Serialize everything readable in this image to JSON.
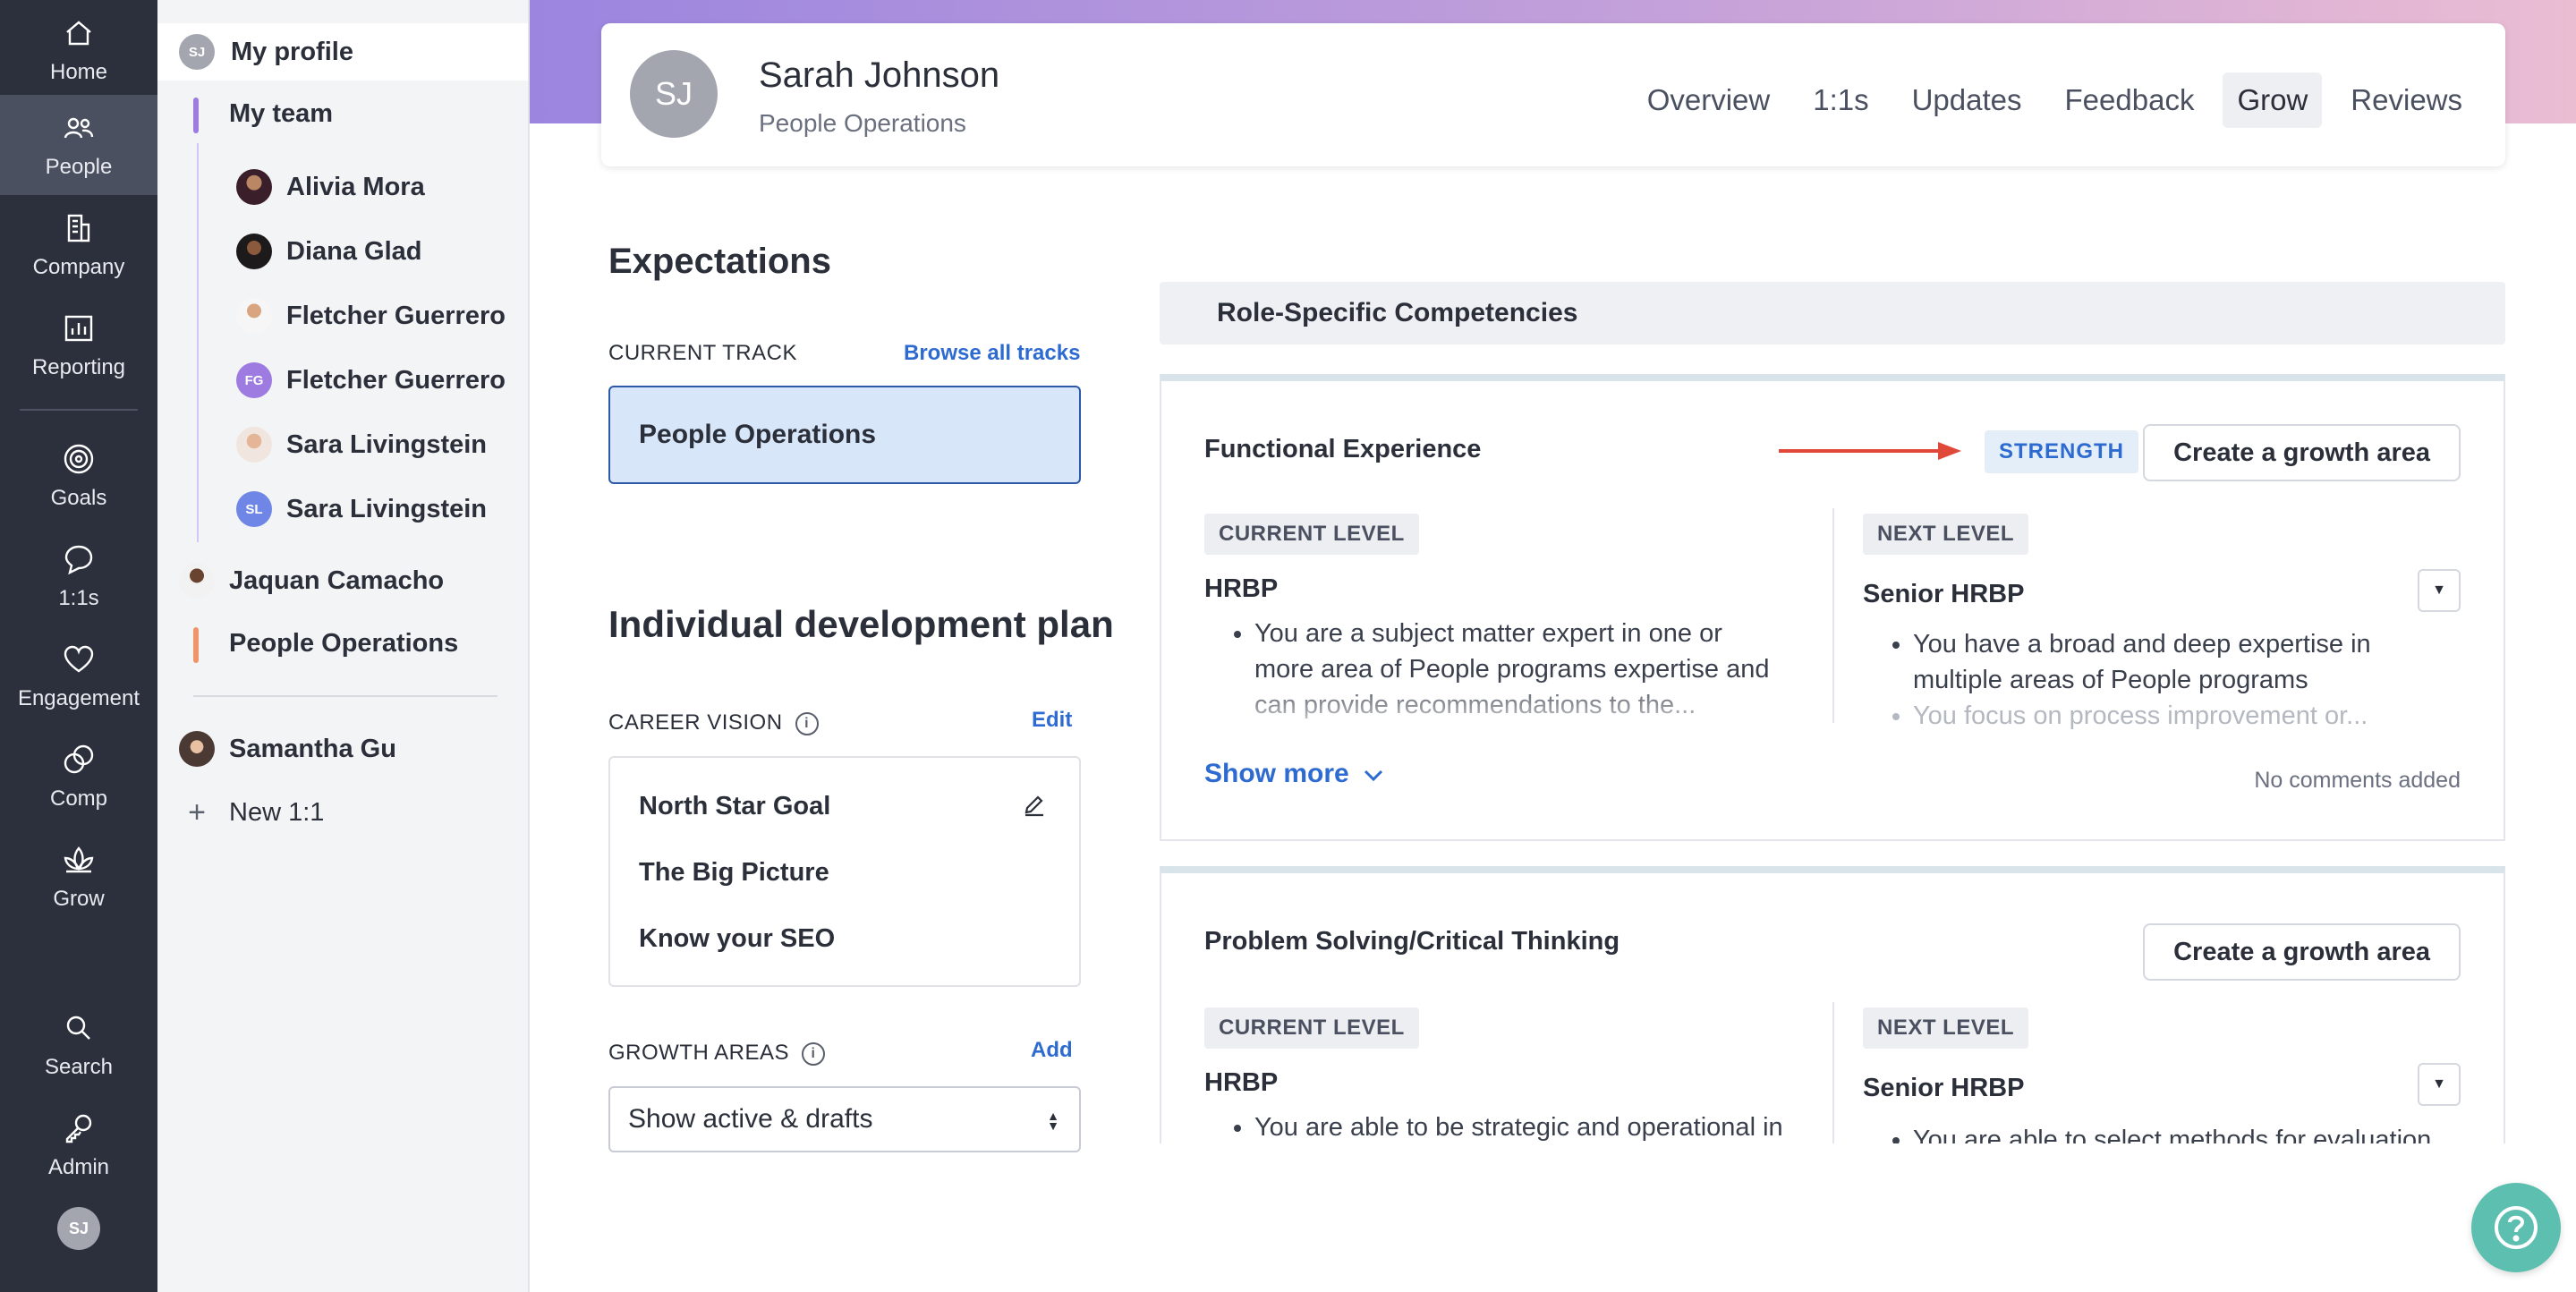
{
  "rail": {
    "items": [
      {
        "label": "Home",
        "icon": "home-icon"
      },
      {
        "label": "People",
        "icon": "people-icon",
        "active": true
      },
      {
        "label": "Company",
        "icon": "company-icon"
      },
      {
        "label": "Reporting",
        "icon": "reporting-icon"
      },
      {
        "label": "Goals",
        "icon": "goals-icon"
      },
      {
        "label": "1:1s",
        "icon": "chat-icon"
      },
      {
        "label": "Engagement",
        "icon": "heart-icon"
      },
      {
        "label": "Comp",
        "icon": "coins-icon"
      },
      {
        "label": "Grow",
        "icon": "lotus-icon"
      },
      {
        "label": "Search",
        "icon": "search-icon"
      },
      {
        "label": "Admin",
        "icon": "key-icon"
      }
    ],
    "avatar_initials": "SJ"
  },
  "subnav": {
    "my_profile": {
      "label": "My profile",
      "initials": "SJ"
    },
    "my_team": "My team",
    "team": [
      {
        "name": "Alivia Mora"
      },
      {
        "name": "Diana Glad"
      },
      {
        "name": "Fletcher Guerrero"
      },
      {
        "name": "Fletcher Guerrero",
        "initials": "FG"
      },
      {
        "name": "Sara Livingstein"
      },
      {
        "name": "Sara Livingstein",
        "initials": "SL"
      }
    ],
    "jaquan": "Jaquan Camacho",
    "people_ops": "People Operations",
    "samantha": "Samantha Gu",
    "new_1on1": "New 1:1",
    "colors": {
      "team_bar": "#9d7be0",
      "people_ops_bar": "#f0956a"
    }
  },
  "header": {
    "initials": "SJ",
    "name": "Sarah Johnson",
    "dept": "People Operations",
    "tabs": [
      "Overview",
      "1:1s",
      "Updates",
      "Feedback",
      "Grow",
      "Reviews"
    ],
    "active_tab": "Grow"
  },
  "expectations": {
    "title": "Expectations",
    "current_track_label": "CURRENT TRACK",
    "browse_link": "Browse all tracks",
    "track": "People Operations"
  },
  "idp": {
    "title": "Individual development plan",
    "career_vision_label": "CAREER VISION",
    "edit_link": "Edit",
    "vision_items": [
      "North Star Goal",
      "The Big Picture",
      "Know your SEO"
    ],
    "growth_areas_label": "GROWTH AREAS",
    "add_link": "Add",
    "filter_value": "Show active & drafts"
  },
  "competencies": {
    "section_title": "Role-Specific Competencies",
    "cards": [
      {
        "title": "Functional Experience",
        "badge": "STRENGTH",
        "button": "Create a growth area",
        "current_label": "CURRENT LEVEL",
        "current_level": "HRBP",
        "current_bullet": "You are a subject matter expert in one or more area of People programs expertise and can provide recommendations to the...",
        "next_label": "NEXT LEVEL",
        "next_level": "Senior HRBP",
        "next_bullet_1": "You have a broad and deep expertise in multiple areas of People programs",
        "next_bullet_2": "You focus on process improvement or...",
        "show_more": "Show more",
        "comments": "No comments added"
      },
      {
        "title": "Problem Solving/Critical Thinking",
        "button": "Create a growth area",
        "current_label": "CURRENT LEVEL",
        "current_level": "HRBP",
        "current_bullet": "You are able to be strategic and operational in",
        "next_label": "NEXT LEVEL",
        "next_level": "Senior HRBP",
        "next_bullet_1": "You are able to select methods for evaluation"
      }
    ]
  },
  "colors": {
    "accent": "#2e6bd1",
    "rail_bg": "#2c303c",
    "arrow": "#e0483a",
    "help": "#5dbfb0"
  }
}
